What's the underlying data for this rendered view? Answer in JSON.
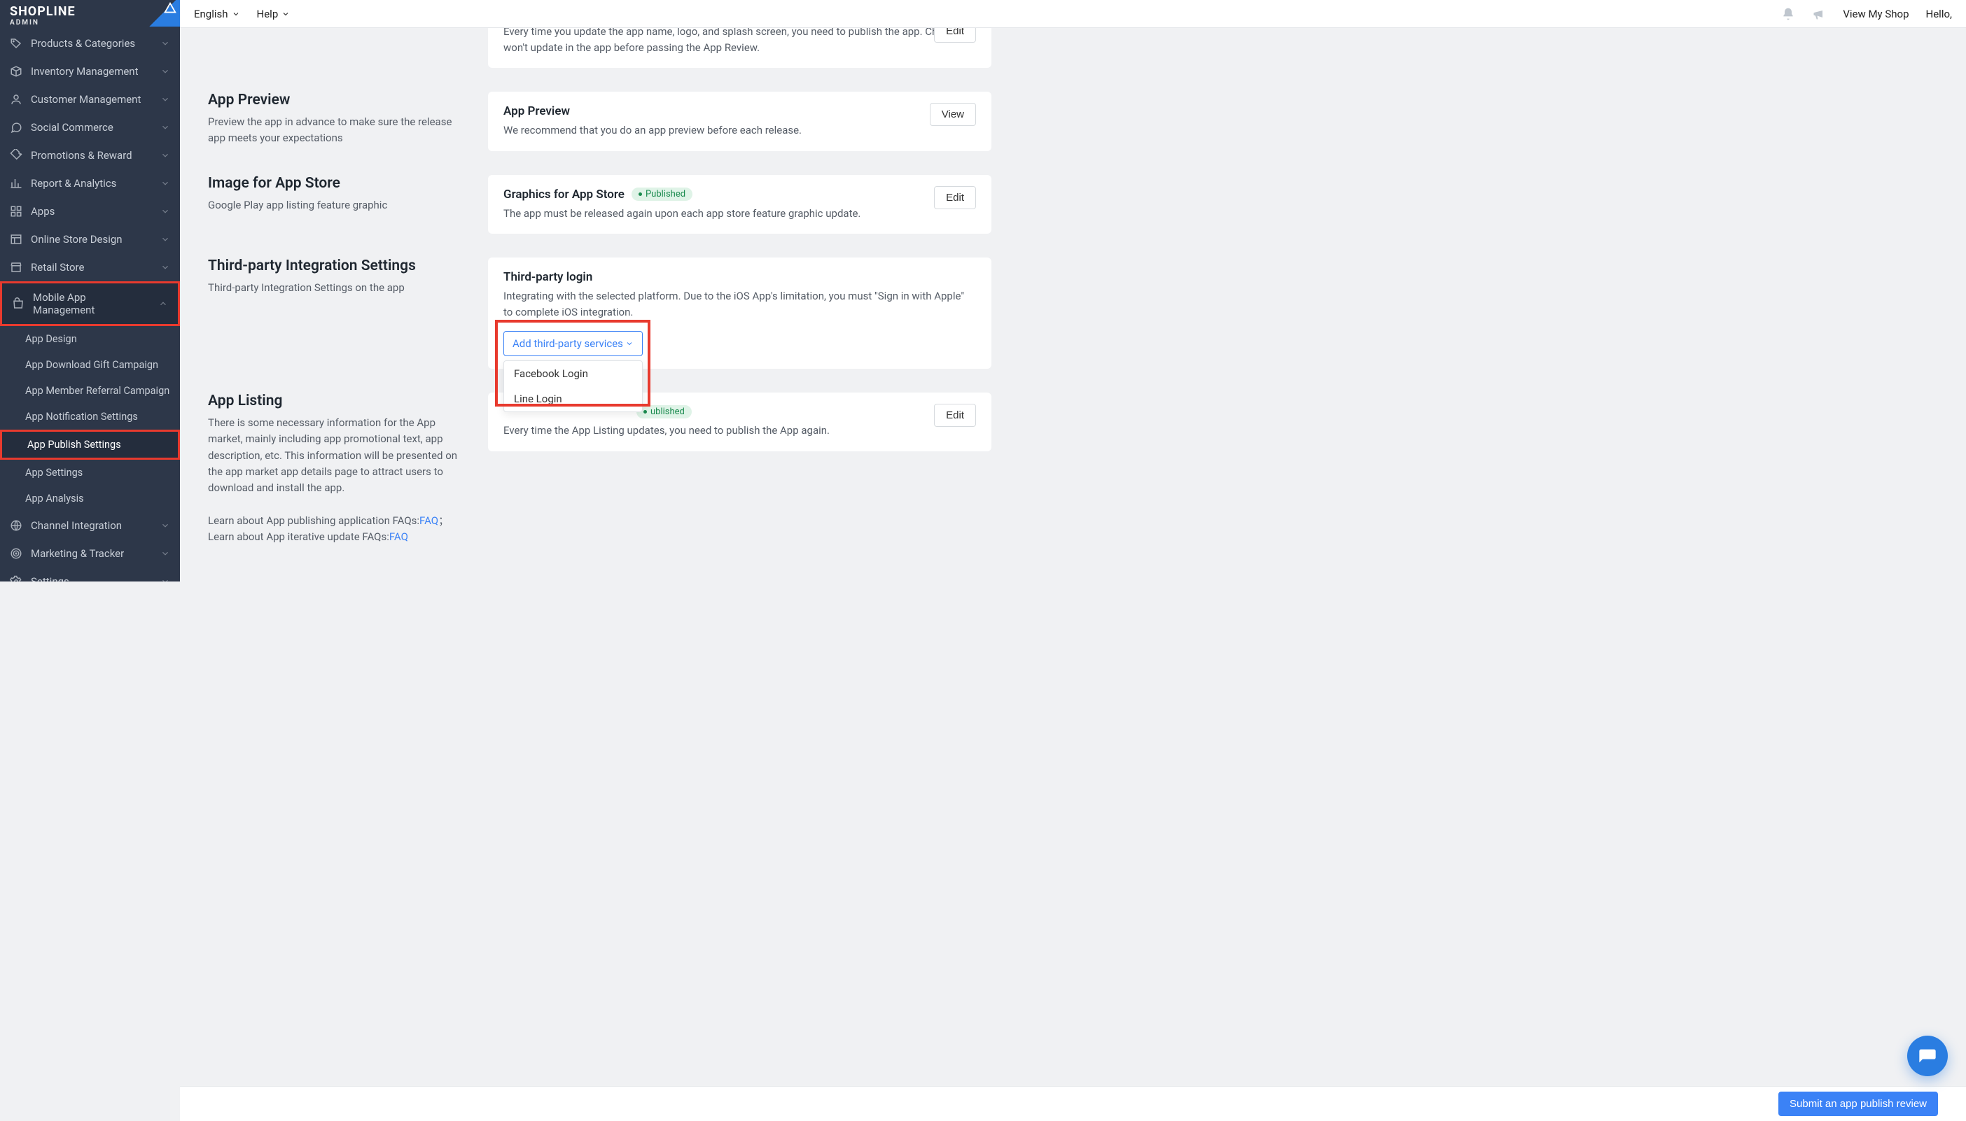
{
  "brand": {
    "name": "SHOPLINE",
    "sub": "ADMIN"
  },
  "topbar": {
    "lang": "English",
    "help": "Help",
    "view_shop": "View My Shop",
    "greeting": "Hello,"
  },
  "sidebar": {
    "items": [
      {
        "label": "Products & Categories"
      },
      {
        "label": "Inventory Management"
      },
      {
        "label": "Customer Management"
      },
      {
        "label": "Social Commerce"
      },
      {
        "label": "Promotions & Reward"
      },
      {
        "label": "Report & Analytics"
      },
      {
        "label": "Apps"
      },
      {
        "label": "Online Store Design"
      },
      {
        "label": "Retail Store"
      },
      {
        "label": "Mobile App Management",
        "highlight": true,
        "expanded": true
      },
      {
        "label": "Channel Integration"
      },
      {
        "label": "Marketing & Tracker"
      },
      {
        "label": "Settings"
      }
    ],
    "mobile_sub": [
      {
        "label": "App Design"
      },
      {
        "label": "App Download Gift Campaign"
      },
      {
        "label": "App Member Referral Campaign"
      },
      {
        "label": "App Notification Settings"
      },
      {
        "label": "App Publish Settings",
        "active": true,
        "highlight": true
      },
      {
        "label": "App Settings"
      },
      {
        "label": "App Analysis"
      }
    ]
  },
  "sections": {
    "top_card": {
      "text": "Every time you update the app name, logo, and splash screen, you need to publish the app. Changes won't update in the app before passing the App Review.",
      "btn": "Edit"
    },
    "preview": {
      "title": "App Preview",
      "desc": "Preview the app in advance to make sure the release app meets your expectations",
      "card_title": "App Preview",
      "card_text": "We recommend that you do an app preview before each release.",
      "btn": "View"
    },
    "image": {
      "title": "Image for App Store",
      "desc": "Google Play app listing feature graphic",
      "card_title": "Graphics for App Store",
      "badge": "Published",
      "card_text": "The app must be released again upon each app store feature graphic update.",
      "btn": "Edit"
    },
    "third": {
      "title": "Third-party Integration Settings",
      "desc": "Third-party Integration Settings on the app",
      "card_title": "Third-party login",
      "card_text": "Integrating with the selected platform. Due to the iOS App's limitation, you must \"Sign in with Apple\" to complete iOS integration.",
      "dropdown_label": "Add third-party services",
      "options": [
        "Facebook Login",
        "Line Login"
      ]
    },
    "listing": {
      "title": "App Listing",
      "desc_1": "There is some necessary information for the App market, mainly including app promotional text, app description, etc. This information will be presented on the app market app details page to attract users to download and install the app.",
      "desc_2a": "Learn about App publishing application FAQs:",
      "faq1": "FAQ",
      "desc_2b": "；Learn about App iterative update FAQs:",
      "faq2": "FAQ",
      "badge": "ublished",
      "card_text": "Every time the App Listing updates, you need to publish the App again.",
      "btn": "Edit"
    }
  },
  "footer": {
    "submit": "Submit an app publish review"
  }
}
